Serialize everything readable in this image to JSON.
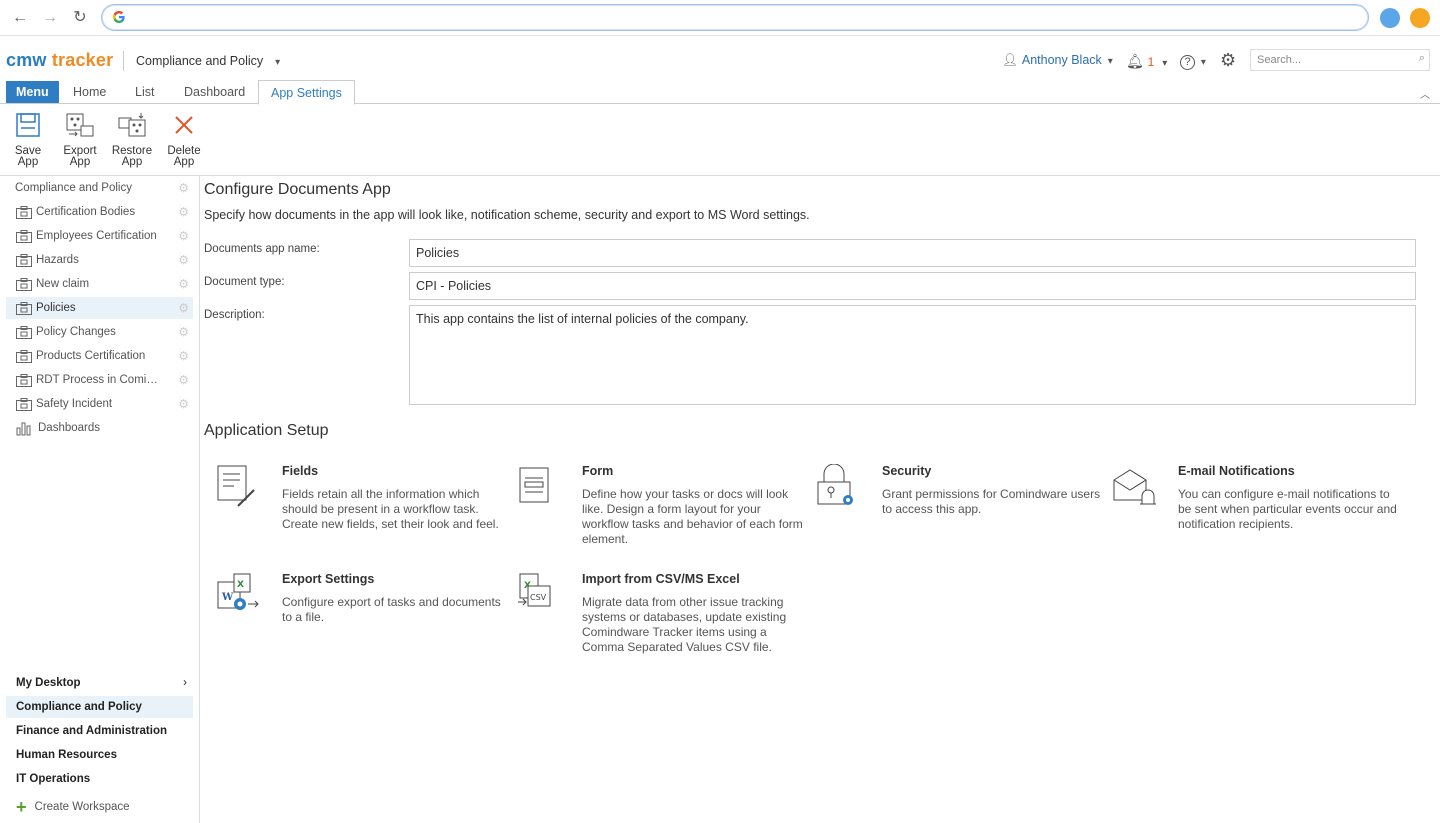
{
  "browser": {
    "address_value": ""
  },
  "header": {
    "logo_part1": "cmw",
    "logo_part2": "tracker",
    "workspace": "Compliance and Policy",
    "user": "Anthony Black",
    "notification_count": "1",
    "search_placeholder": "Search..."
  },
  "tabs": {
    "menu": "Menu",
    "home": "Home",
    "list": "List",
    "dashboard": "Dashboard",
    "app_settings": "App Settings"
  },
  "ribbon": {
    "save": [
      "Save",
      "App"
    ],
    "export": [
      "Export",
      "App"
    ],
    "restore": [
      "Restore",
      "App"
    ],
    "delete": [
      "Delete",
      "App"
    ]
  },
  "sidebar": {
    "root": "Compliance and Policy",
    "items": [
      {
        "label": "Certification Bodies"
      },
      {
        "label": "Employees Certification"
      },
      {
        "label": "Hazards"
      },
      {
        "label": "New claim"
      },
      {
        "label": "Policies"
      },
      {
        "label": "Policy Changes"
      },
      {
        "label": "Products Certification"
      },
      {
        "label": "RDT Process in Comindware"
      },
      {
        "label": "Safety Incident"
      }
    ],
    "dashboards": "Dashboards",
    "workspaces": [
      {
        "label": "My Desktop"
      },
      {
        "label": "Compliance and Policy"
      },
      {
        "label": "Finance and Administration"
      },
      {
        "label": "Human Resources"
      },
      {
        "label": "IT Operations"
      }
    ],
    "create_workspace": "Create Workspace"
  },
  "main": {
    "title": "Configure Documents App",
    "description": "Specify how documents in the app will look like, notification scheme, security and export to MS Word settings.",
    "fields": {
      "name_label": "Documents app name:",
      "name_value": "Policies",
      "type_label": "Document type:",
      "type_value": "CPI - Policies",
      "desc_label": "Description:",
      "desc_value": "This app contains the list of internal policies of the company."
    },
    "setup_title": "Application Setup",
    "cards": [
      {
        "title": "Fields",
        "text": "Fields retain all the information which should be present in a workflow task. Create new fields, set their look and feel."
      },
      {
        "title": "Form",
        "text": "Define how your tasks or docs will look like. Design a form layout for your workflow tasks and behavior of each form element."
      },
      {
        "title": "Security",
        "text": "Grant permissions for Comindware users to access this app."
      },
      {
        "title": "E-mail Notifications",
        "text": "You can configure e-mail notifications to be sent when particular events occur and notification recipients."
      },
      {
        "title": "Export Settings",
        "text": "Configure export of tasks and documents to a file."
      },
      {
        "title": "Import from CSV/MS Excel",
        "text": "Migrate data from other issue tracking systems or databases, update existing Comindware Tracker items using a Comma Separated Values CSV file."
      }
    ]
  },
  "colors": {
    "accent": "#2f7ec4",
    "logo_blue": "#2a7fc1",
    "logo_orange": "#f08a24",
    "selected_bg": "#e9f1f9"
  }
}
